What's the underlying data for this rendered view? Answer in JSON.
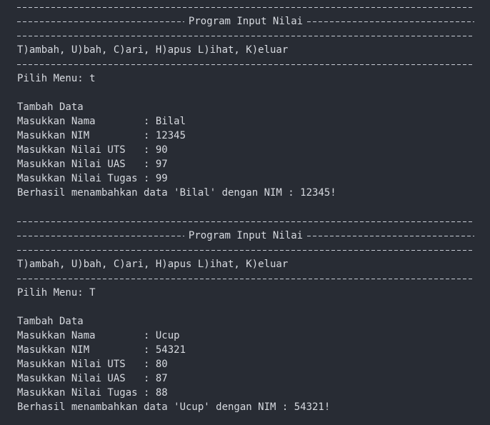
{
  "title": "Program Input Nilai",
  "menu": "T)ambah, U)bah, C)ari, H)apus L)ihat, K)eluar",
  "sessions": [
    {
      "prompt": "Pilih Menu: t",
      "heading": "Tambah Data",
      "fields": [
        "Masukkan Nama        : Bilal",
        "Masukkan NIM         : 12345",
        "Masukkan Nilai UTS   : 90",
        "Masukkan Nilai UAS   : 97",
        "Masukkan Nilai Tugas : 99"
      ],
      "result": "Berhasil menambahkan data 'Bilal' dengan NIM : 12345!"
    },
    {
      "prompt": "Pilih Menu: T",
      "heading": "Tambah Data",
      "fields": [
        "Masukkan Nama        : Ucup",
        "Masukkan NIM         : 54321",
        "Masukkan Nilai UTS   : 80",
        "Masukkan Nilai UAS   : 87",
        "Masukkan Nilai Tugas : 88"
      ],
      "result": "Berhasil menambahkan data 'Ucup' dengan NIM : 54321!"
    }
  ]
}
